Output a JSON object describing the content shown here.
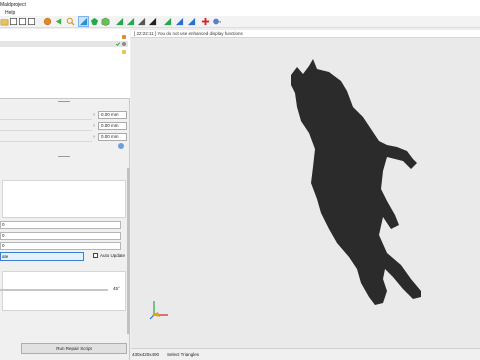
{
  "window": {
    "title": "Maldproject"
  },
  "menu": {
    "help_label": "Help"
  },
  "toolbar": {
    "icons": [
      "folder-icon",
      "save-icon",
      "undo-icon",
      "redo-icon",
      "sphere-icon",
      "arrow-left-icon",
      "search-icon",
      "select-triangle-icon",
      "green-gem-icon",
      "cube-icon",
      "triangle-icon",
      "triangle-icon",
      "triangle-icon",
      "triangle-icon",
      "triangle-icon",
      "triangle-icon",
      "triangle-icon",
      "add-icon",
      "settings-icon"
    ]
  },
  "properties": {
    "fields": [
      {
        "value": "0.00 mm"
      },
      {
        "value": "0.00 mm"
      },
      {
        "value": "0.00 mm"
      }
    ]
  },
  "tool": {
    "fields": [
      {
        "value": "0"
      },
      {
        "value": "0"
      },
      {
        "value": "0"
      }
    ],
    "primary_button_label": "ate",
    "auto_update_label": "Auto Update",
    "angle_label": "45°",
    "run_repair_label": "Run Repair Script"
  },
  "viewport": {
    "message": "[ 22:22:11 ] You do not use enhanced display functions"
  },
  "status": {
    "dimensions": "430x420x400",
    "selection_mode": "Select Triangles"
  },
  "colors": {
    "model_fill": "#2b2b2b",
    "viewport_bg": "#eaeaea",
    "active_tool_bg": "#cce4f7",
    "primary_button_border": "#3c7fd8"
  }
}
